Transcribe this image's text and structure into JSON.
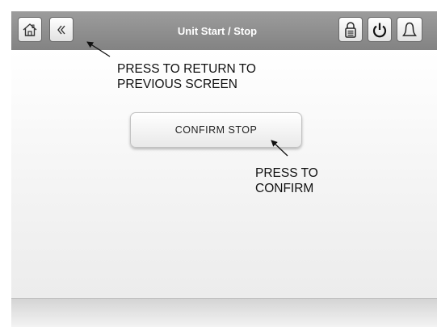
{
  "header": {
    "title": "Unit Start / Stop",
    "left_icons": [
      "home-icon",
      "back-icon"
    ],
    "right_icons": [
      "lock-icon",
      "power-icon",
      "alarm-bell-icon"
    ]
  },
  "main": {
    "confirm_button_label": "CONFIRM STOP"
  },
  "annotations": {
    "back": [
      "PRESS TO RETURN TO",
      "PREVIOUS SCREEN"
    ],
    "confirm": [
      "PRESS TO",
      "CONFIRM"
    ]
  }
}
